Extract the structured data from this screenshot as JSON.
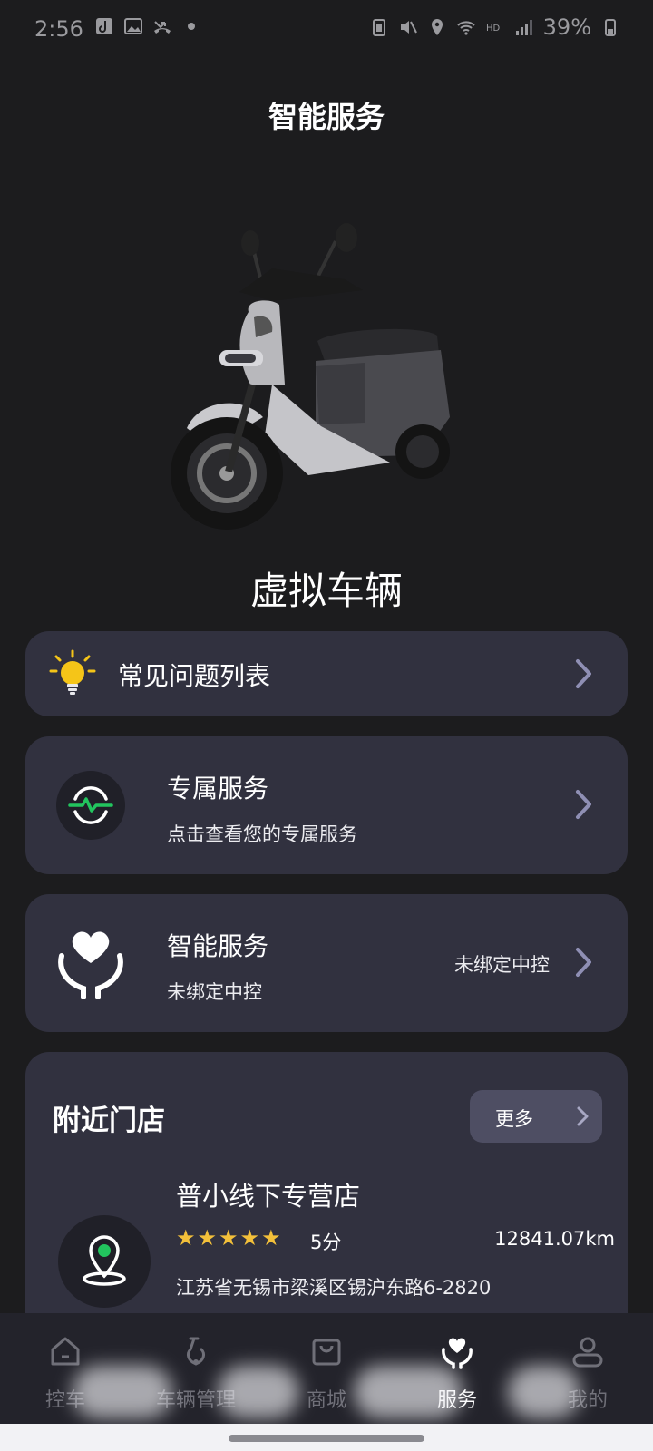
{
  "status_bar": {
    "time": "2:56",
    "battery": "39%"
  },
  "page_title": "智能服务",
  "vehicle_name": "虚拟车辆",
  "faq": {
    "label": "常见问题列表"
  },
  "exclusive_service": {
    "title": "专属服务",
    "subtitle": "点击查看您的专属服务"
  },
  "smart_service": {
    "title": "智能服务",
    "subtitle": "未绑定中控",
    "status": "未绑定中控"
  },
  "nearby": {
    "title": "附近门店",
    "more_label": "更多",
    "store": {
      "name": "普小线下专营店",
      "rating": "5分",
      "rating_value": 5,
      "distance": "12841.07km",
      "address": "江苏省无锡市梁溪区锡沪东路6-2820"
    }
  },
  "tabbar": {
    "items": [
      {
        "label": "控车",
        "icon": "home-icon"
      },
      {
        "label": "车辆管理",
        "icon": "scooter-icon"
      },
      {
        "label": "商城",
        "icon": "shopping-bag-icon"
      },
      {
        "label": "服务",
        "icon": "heart-hands-icon"
      },
      {
        "label": "我的",
        "icon": "user-icon"
      }
    ],
    "active": "服务"
  },
  "colors": {
    "background": "#1c1c1e",
    "card": "#31313f",
    "star": "#f3c03a",
    "accent_green": "#22c55e",
    "button_blue": "#2c6ef0"
  }
}
